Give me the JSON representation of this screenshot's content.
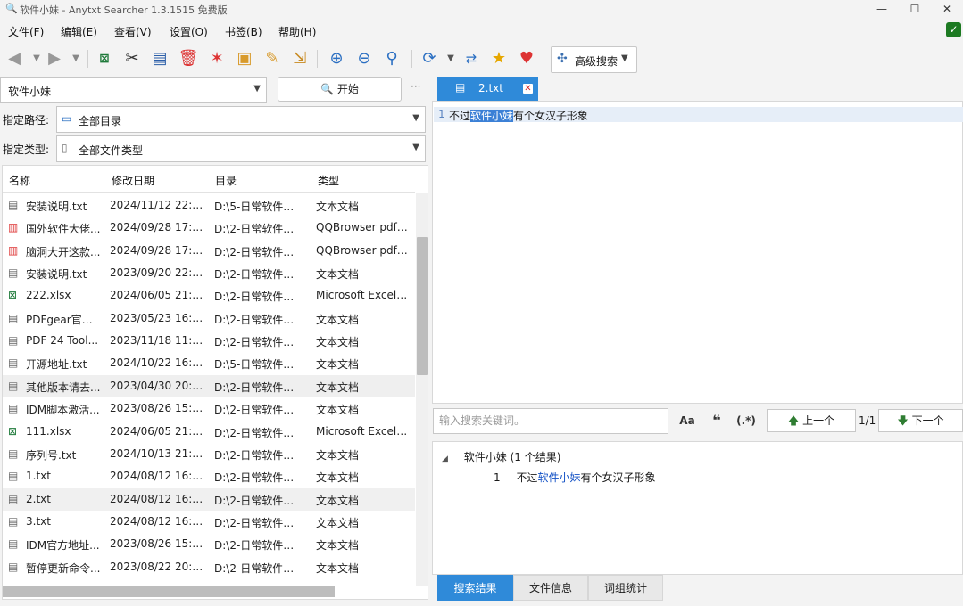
{
  "window": {
    "title": "软件小妹 - Anytxt Searcher 1.3.1515 免费版",
    "minimize": "—",
    "maximize": "☐",
    "close": "✕"
  },
  "menu": [
    "文件(F)",
    "编辑(E)",
    "查看(V)",
    "设置(O)",
    "书签(B)",
    "帮助(H)"
  ],
  "toolbar": {
    "advanced_search": "高级搜索"
  },
  "search": {
    "keyword": "软件小妹",
    "start_label": "开始",
    "more": "···",
    "path_label": "指定路径:",
    "path_value": "全部目录",
    "type_label": "指定类型:",
    "type_value": "全部文件类型"
  },
  "list": {
    "columns": [
      "名称",
      "修改日期",
      "目录",
      "类型"
    ],
    "rows": [
      {
        "icon": "txt",
        "name": "安装说明.txt",
        "date": "2024/11/12 22:3...",
        "dir": "D:\\5-日常软件推...",
        "type": "文本文档"
      },
      {
        "icon": "pdf",
        "name": "国外软件大佬...",
        "date": "2024/09/28 17:5...",
        "dir": "D:\\2-日常软件推...",
        "type": "QQBrowser pdf ..."
      },
      {
        "icon": "pdf",
        "name": "脑洞大开这款...",
        "date": "2024/09/28 17:5...",
        "dir": "D:\\2-日常软件推...",
        "type": "QQBrowser pdf ..."
      },
      {
        "icon": "txt",
        "name": "安装说明.txt",
        "date": "2023/09/20 22:0...",
        "dir": "D:\\2-日常软件推...",
        "type": "文本文档"
      },
      {
        "icon": "xlsx",
        "name": "222.xlsx",
        "date": "2024/06/05 21:5...",
        "dir": "D:\\2-日常软件推...",
        "type": "Microsoft Excel ..."
      },
      {
        "icon": "txt",
        "name": "PDFgear官司...",
        "date": "2023/05/23 16:5...",
        "dir": "D:\\2-日常软件推...",
        "type": "文本文档"
      },
      {
        "icon": "txt",
        "name": "PDF 24 Tool...",
        "date": "2023/11/18 11:1...",
        "dir": "D:\\2-日常软件推...",
        "type": "文本文档"
      },
      {
        "icon": "txt",
        "name": "开源地址.txt",
        "date": "2024/10/22 16:2...",
        "dir": "D:\\5-日常软件推...",
        "type": "文本文档"
      },
      {
        "icon": "txt",
        "name": "其他版本请去...",
        "date": "2023/04/30 20:1...",
        "dir": "D:\\2-日常软件推...",
        "type": "文本文档"
      },
      {
        "icon": "txt",
        "name": "IDM脚本激活...",
        "date": "2023/08/26 15:4...",
        "dir": "D:\\2-日常软件推...",
        "type": "文本文档"
      },
      {
        "icon": "xlsx",
        "name": "111.xlsx",
        "date": "2024/06/05 21:5...",
        "dir": "D:\\2-日常软件推...",
        "type": "Microsoft Excel ..."
      },
      {
        "icon": "txt",
        "name": "序列号.txt",
        "date": "2024/10/13 21:1...",
        "dir": "D:\\2-日常软件推...",
        "type": "文本文档"
      },
      {
        "icon": "txt",
        "name": "1.txt",
        "date": "2024/08/12 16:3...",
        "dir": "D:\\2-日常软件推...",
        "type": "文本文档"
      },
      {
        "icon": "txt",
        "name": "2.txt",
        "date": "2024/08/12 16:3...",
        "dir": "D:\\2-日常软件推...",
        "type": "文本文档"
      },
      {
        "icon": "txt",
        "name": "3.txt",
        "date": "2024/08/12 16:3...",
        "dir": "D:\\2-日常软件推...",
        "type": "文本文档"
      },
      {
        "icon": "txt",
        "name": "IDM官方地址...",
        "date": "2023/08/26 15:4...",
        "dir": "D:\\2-日常软件推...",
        "type": "文本文档"
      },
      {
        "icon": "txt",
        "name": "暂停更新命令...",
        "date": "2023/08/22 20:3...",
        "dir": "D:\\2-日常软件推...",
        "type": "文本文档"
      }
    ]
  },
  "document": {
    "tab_title": "2.txt",
    "line_number": "1",
    "text_before": "不过",
    "text_match": "软件小妹",
    "text_after": "有个女汉子形象"
  },
  "find": {
    "placeholder": "输入搜索关键词。",
    "case_btn": "Aa",
    "quote_btn": "❝",
    "regex_btn": "(.*)",
    "prev": "上一个",
    "next": "下一个",
    "count": "1/1"
  },
  "results": {
    "group": "软件小妹 (1 个结果)",
    "line_number": "1",
    "text_before": "不过",
    "text_match": "软件小妹",
    "text_after": "有个女汉子形象"
  },
  "bottom_tabs": [
    "搜索结果",
    "文件信息",
    "词组统计"
  ],
  "colors": {
    "accent": "#2f8ad9",
    "selection": "#3b80d6"
  }
}
